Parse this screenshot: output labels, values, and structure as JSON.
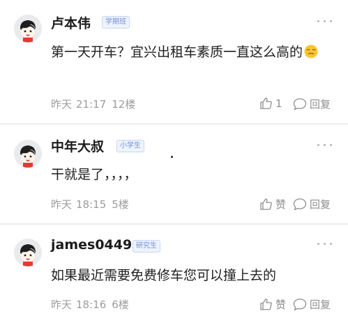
{
  "comments": [
    {
      "username": "卢本伟",
      "badge": "学期班",
      "text": "第一天开车？宜兴出租车素质一直这么高的",
      "date": "昨天",
      "time": "21:17",
      "floor": "12楼",
      "like_label": "1",
      "reply_label": "回复"
    },
    {
      "username": "中年大叔",
      "badge": "小学生",
      "text": "干就是了，，，，",
      "date": "昨天",
      "time": "18:15",
      "floor": "5楼",
      "like_label": "赞",
      "reply_label": "回复"
    },
    {
      "username": "james0449",
      "badge": "研究生",
      "text": "如果最近需要免费修车您可以撞上去的",
      "date": "昨天",
      "time": "18:16",
      "floor": "6楼",
      "like_label": "赞",
      "reply_label": "回复"
    }
  ],
  "icons": {
    "avatar": "cartoon-face-avatar",
    "like": "thumbs-up-icon",
    "reply": "speech-bubble-icon",
    "more": "more-dots-icon",
    "emoji": "smirk-emoji-icon"
  },
  "colors": {
    "badge_text": "#6f8fd4",
    "badge_bg": "#eef3fe",
    "meta_text": "#9c9c9c"
  }
}
